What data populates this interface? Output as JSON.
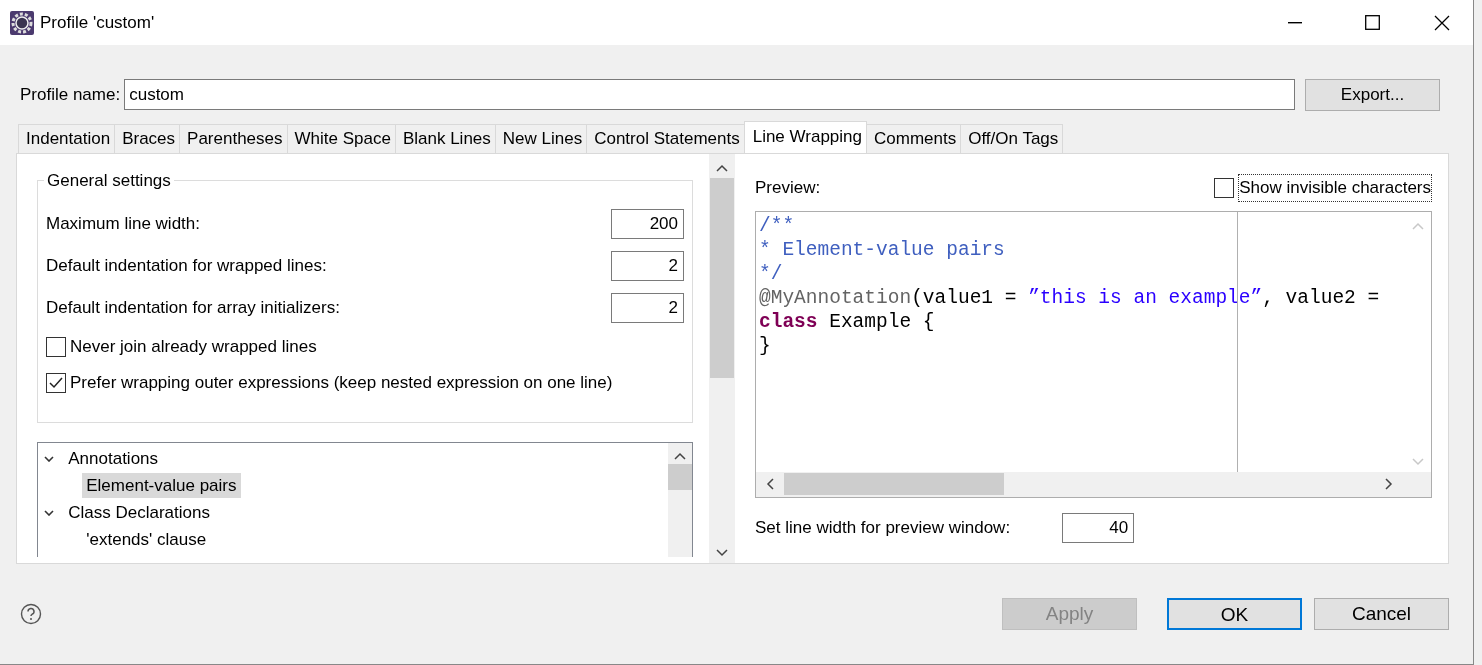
{
  "window": {
    "title": "Profile 'custom'"
  },
  "profile": {
    "label": "Profile name:",
    "value": "custom",
    "export_button": "Export..."
  },
  "tabs": [
    {
      "label": "Indentation",
      "selected": false
    },
    {
      "label": "Braces",
      "selected": false
    },
    {
      "label": "Parentheses",
      "selected": false
    },
    {
      "label": "White Space",
      "selected": false
    },
    {
      "label": "Blank Lines",
      "selected": false
    },
    {
      "label": "New Lines",
      "selected": false
    },
    {
      "label": "Control Statements",
      "selected": false
    },
    {
      "label": "Line Wrapping",
      "selected": true
    },
    {
      "label": "Comments",
      "selected": false
    },
    {
      "label": "Off/On Tags",
      "selected": false
    }
  ],
  "general_settings": {
    "title": "General settings",
    "fields": [
      {
        "label": "Maximum line width:",
        "value": "200"
      },
      {
        "label": "Default indentation for wrapped lines:",
        "value": "2"
      },
      {
        "label": "Default indentation for array initializers:",
        "value": "2"
      }
    ],
    "options": [
      {
        "label": "Never join already wrapped lines",
        "checked": false
      },
      {
        "label": "Prefer wrapping outer expressions (keep nested expression on one line)",
        "checked": true
      }
    ]
  },
  "tree": [
    {
      "label": "Annotations",
      "expanded": true,
      "selected": false,
      "children": [
        {
          "label": "Element-value pairs",
          "selected": true
        }
      ]
    },
    {
      "label": "Class Declarations",
      "expanded": true,
      "selected": false,
      "children": [
        {
          "label": "'extends' clause",
          "selected": false
        }
      ]
    }
  ],
  "preview": {
    "label": "Preview:",
    "show_invisible": {
      "label": "Show invisible characters",
      "checked": false
    },
    "code": [
      [
        {
          "kind": "comment",
          "text": "/**"
        }
      ],
      [
        {
          "kind": "comment",
          "text": "* Element-value pairs"
        }
      ],
      [
        {
          "kind": "comment",
          "text": "*/"
        }
      ],
      [
        {
          "kind": "annotation",
          "text": "@MyAnnotation"
        },
        {
          "kind": "plain",
          "text": "(value1 = "
        },
        {
          "kind": "string",
          "text": "”this is an example”"
        },
        {
          "kind": "plain",
          "text": ", value2 ="
        }
      ],
      [
        {
          "kind": "keyword",
          "text": "class"
        },
        {
          "kind": "plain",
          "text": " Example {"
        }
      ],
      [
        {
          "kind": "plain",
          "text": "}"
        }
      ]
    ],
    "line_width_label": "Set line width for preview window:",
    "line_width_value": "40"
  },
  "buttons": [
    {
      "label": "Apply",
      "disabled": true,
      "default": false
    },
    {
      "label": "OK",
      "disabled": false,
      "default": true
    },
    {
      "label": "Cancel",
      "disabled": false,
      "default": false
    }
  ]
}
